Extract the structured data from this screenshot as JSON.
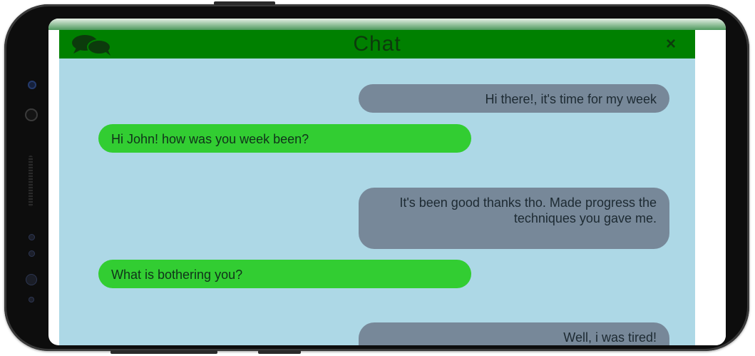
{
  "header": {
    "title": "Chat",
    "close_label": "×",
    "icon": "chat-bubbles-icon"
  },
  "messages": [
    {
      "side": "sent",
      "text": "Hi there!, it's time for my week"
    },
    {
      "side": "received",
      "text": "Hi John! how was you week been?"
    },
    {
      "side": "sent",
      "text": "It's been good thanks tho. Made progress the techniques you gave me."
    },
    {
      "side": "received",
      "text": "What is bothering you?"
    },
    {
      "side": "sent",
      "text": "Well, i was tired!"
    }
  ],
  "colors": {
    "header_bg": "#008000",
    "chat_bg": "#add8e6",
    "sent_bubble": "#778899",
    "received_bubble": "#32cd32"
  }
}
